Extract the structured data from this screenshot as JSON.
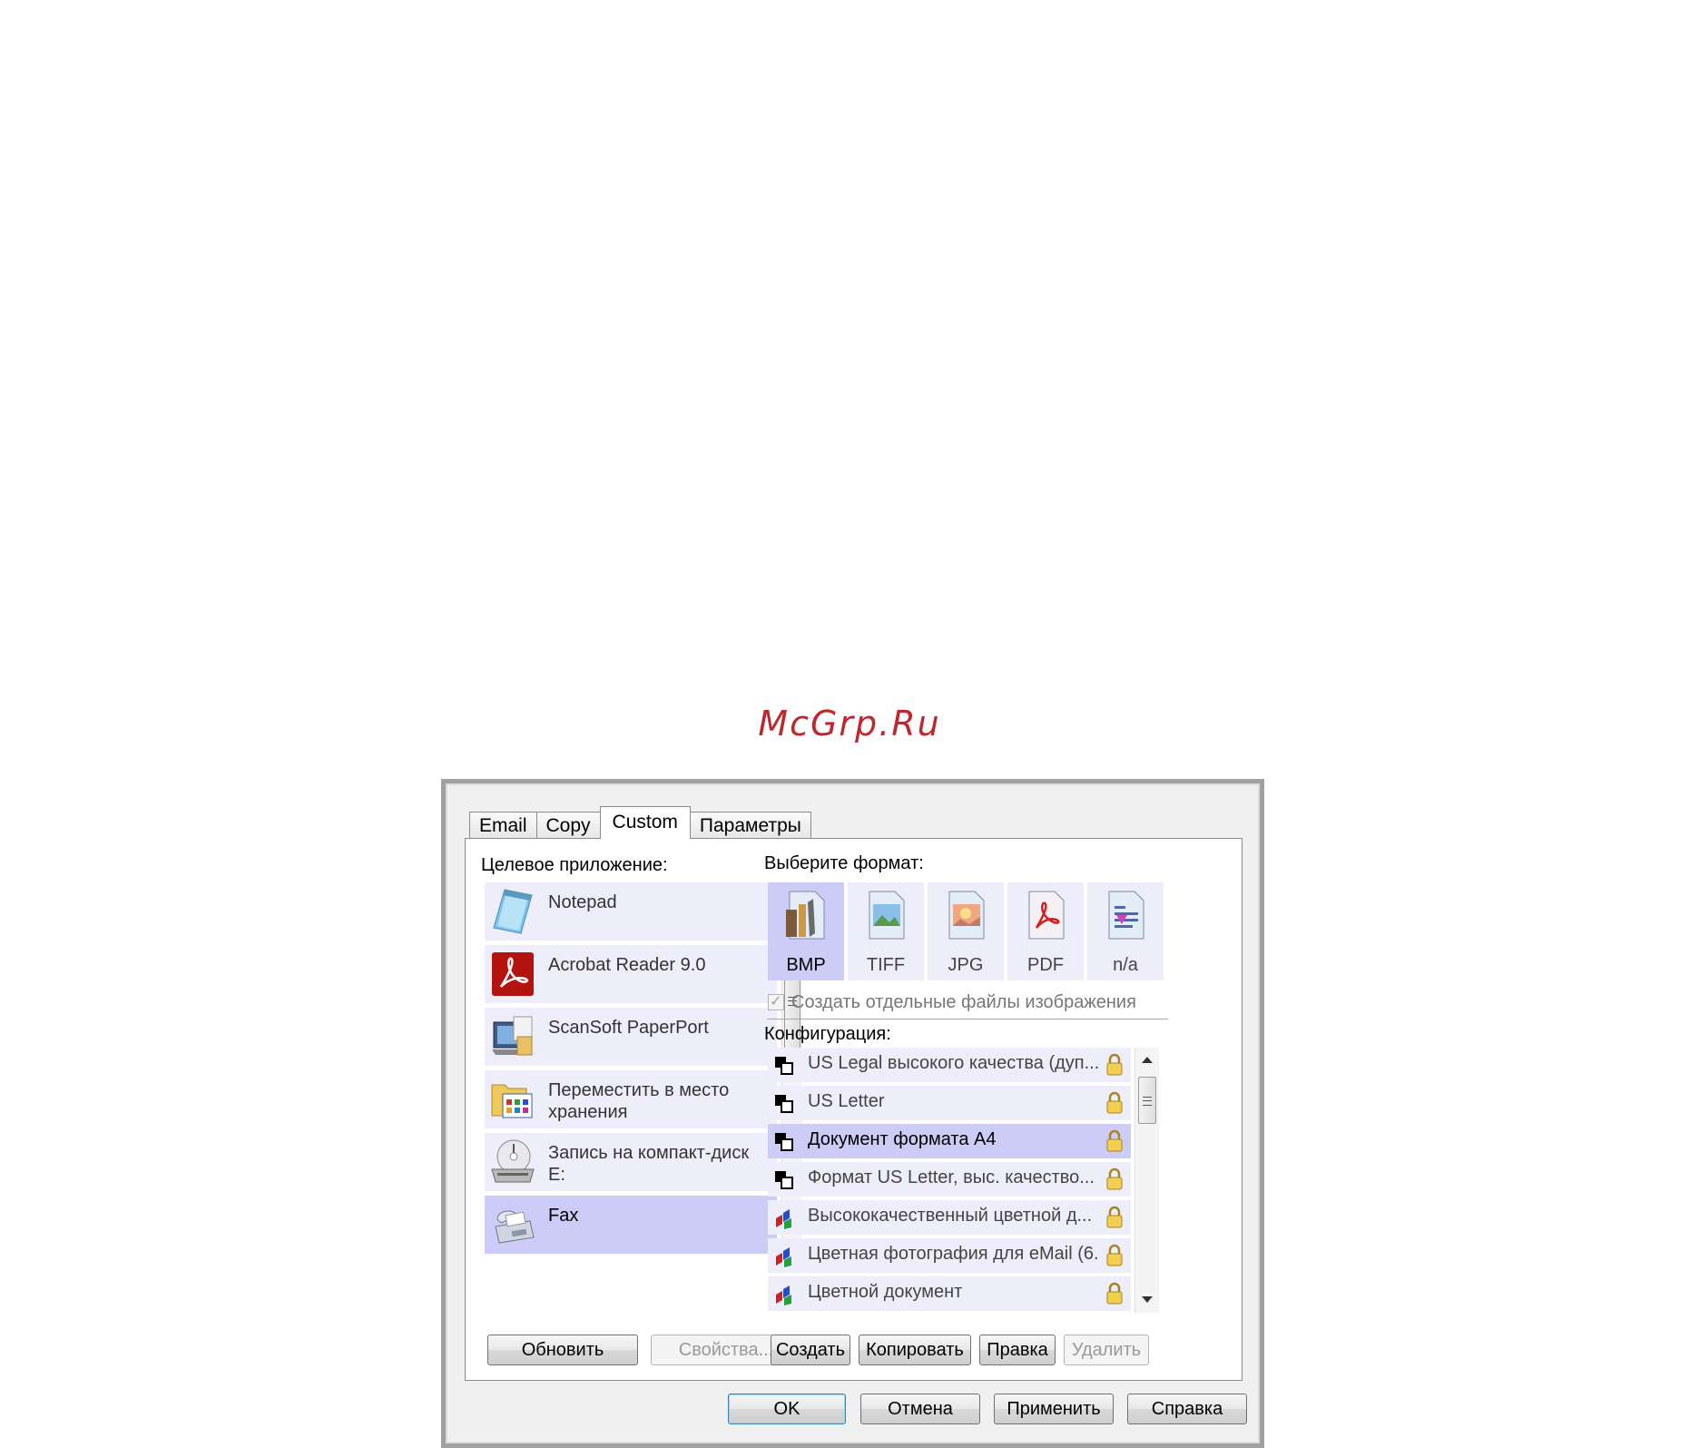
{
  "watermark": "McGrp.Ru",
  "tabs": [
    {
      "label": "Email",
      "active": false
    },
    {
      "label": "Copy",
      "active": false
    },
    {
      "label": "Custom",
      "active": true
    },
    {
      "label": "Параметры",
      "active": false
    }
  ],
  "target_app": {
    "label": "Целевое приложение:",
    "items": [
      {
        "name": "Notepad",
        "icon": "notepad-icon"
      },
      {
        "name": "Acrobat Reader 9.0",
        "icon": "acrobat-icon"
      },
      {
        "name": "ScanSoft PaperPort",
        "icon": "paperport-icon"
      },
      {
        "name": "Переместить в место хранения",
        "icon": "folder-storage-icon"
      },
      {
        "name": "Запись на компакт-диск E:",
        "icon": "cd-burn-icon"
      },
      {
        "name": "Fax",
        "icon": "fax-icon",
        "selected": true
      }
    ],
    "refresh_label": "Обновить",
    "properties_label": "Свойства..."
  },
  "format": {
    "label": "Выберите формат:",
    "items": [
      {
        "label": "BMP",
        "icon": "bmp-icon",
        "selected": true
      },
      {
        "label": "TIFF",
        "icon": "tiff-icon"
      },
      {
        "label": "JPG",
        "icon": "jpg-icon"
      },
      {
        "label": "PDF",
        "icon": "pdf-icon"
      },
      {
        "label": "n/a",
        "icon": "text-doc-icon"
      }
    ],
    "separate_files_label": "Создать отдельные файлы изображения",
    "separate_files_checked": true
  },
  "configuration": {
    "label": "Конфигурация:",
    "items": [
      {
        "name": "US Legal высокого качества (дуп...",
        "type": "bw"
      },
      {
        "name": "US Letter",
        "type": "bw"
      },
      {
        "name": "Документ формата A4",
        "type": "bw",
        "selected": true
      },
      {
        "name": "Формат US Letter, выс. качество...",
        "type": "bw"
      },
      {
        "name": "Высококачественный цветной д...",
        "type": "color"
      },
      {
        "name": "Цветная фотография для eMail (6...",
        "type": "color"
      },
      {
        "name": "Цветной документ",
        "type": "color"
      }
    ],
    "create_label": "Создать",
    "copy_label": "Копировать",
    "edit_label": "Правка",
    "delete_label": "Удалить"
  },
  "footer": {
    "ok_label": "OK",
    "cancel_label": "Отмена",
    "apply_label": "Применить",
    "help_label": "Справка"
  },
  "colors": {
    "list_item": "#eeeefa",
    "list_selected": "#ccccf7",
    "watermark": "#c0272d"
  }
}
